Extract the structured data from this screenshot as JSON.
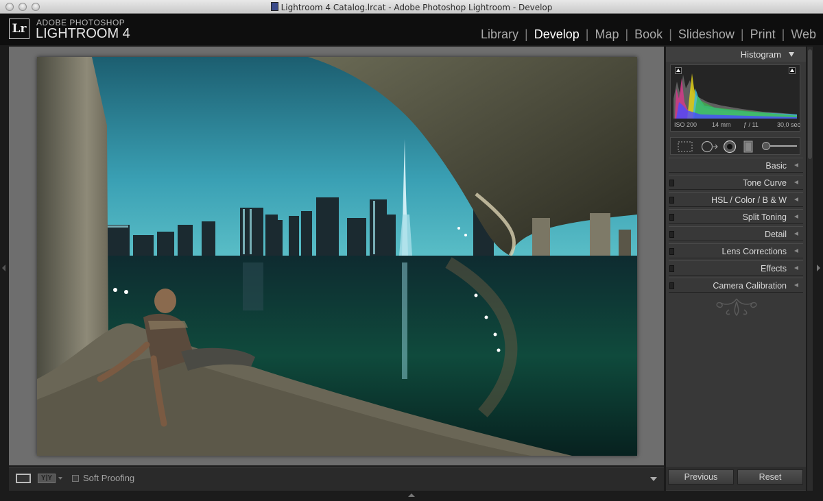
{
  "window": {
    "title": "Lightroom 4 Catalog.lrcat - Adobe Photoshop Lightroom - Develop"
  },
  "brand": {
    "logo": "Lr",
    "small": "ADOBE PHOTOSHOP",
    "large": "LIGHTROOM 4"
  },
  "modules": [
    {
      "label": "Library",
      "active": false
    },
    {
      "label": "Develop",
      "active": true
    },
    {
      "label": "Map",
      "active": false
    },
    {
      "label": "Book",
      "active": false
    },
    {
      "label": "Slideshow",
      "active": false
    },
    {
      "label": "Print",
      "active": false
    },
    {
      "label": "Web",
      "active": false
    }
  ],
  "histogram": {
    "title": "Histogram",
    "iso": "ISO 200",
    "focal": "14 mm",
    "aperture": "ƒ / 11",
    "shutter": "30,0 sec"
  },
  "panels": [
    {
      "label": "Basic",
      "switch": false
    },
    {
      "label": "Tone Curve",
      "switch": true
    },
    {
      "label": "HSL  /  Color  /  B & W",
      "switch": true
    },
    {
      "label": "Split Toning",
      "switch": true
    },
    {
      "label": "Detail",
      "switch": true
    },
    {
      "label": "Lens Corrections",
      "switch": true
    },
    {
      "label": "Effects",
      "switch": true
    },
    {
      "label": "Camera Calibration",
      "switch": true
    }
  ],
  "toolbar": {
    "soft_proofing": "Soft Proofing",
    "yy": "Y|Y"
  },
  "buttons": {
    "previous": "Previous",
    "reset": "Reset"
  }
}
